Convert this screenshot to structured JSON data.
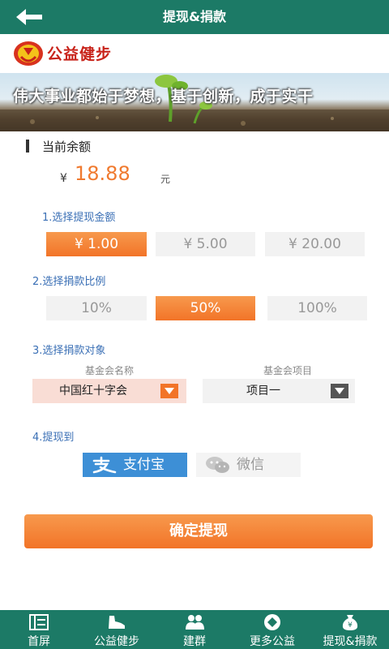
{
  "header": {
    "title": "提现&捐款"
  },
  "logo": {
    "text": "公益健步"
  },
  "banner": {
    "slogan": "伟大事业都始于梦想，基于创新，成于实干"
  },
  "balance": {
    "label": "当前余额",
    "currency": "¥",
    "value": "18.88",
    "unit": "元"
  },
  "steps": {
    "amount": {
      "label": "1.选择提现金额",
      "options": [
        "¥ 1.00",
        "¥ 5.00",
        "¥ 20.00"
      ],
      "selected_index": 0
    },
    "ratio": {
      "label": "2.选择捐款比例",
      "options": [
        "10%",
        "50%",
        "100%"
      ],
      "selected_index": 1
    },
    "target": {
      "label": "3.选择捐款对象",
      "foundation_label": "基金会名称",
      "foundation_value": "中国红十字会",
      "project_label": "基金会项目",
      "project_value": "项目一"
    },
    "withdraw_to": {
      "label": "4.提现到",
      "alipay": "支付宝",
      "wechat": "微信",
      "selected": "alipay"
    }
  },
  "confirm": {
    "label": "确定提现"
  },
  "tabbar": [
    {
      "label": "首屏",
      "icon": "home-list-icon"
    },
    {
      "label": "公益健步",
      "icon": "shoe-icon"
    },
    {
      "label": "建群",
      "icon": "group-icon"
    },
    {
      "label": "更多公益",
      "icon": "more-icon"
    },
    {
      "label": "提现&捐款",
      "icon": "money-bag-icon"
    }
  ],
  "colors": {
    "header": "#1c7a66",
    "accent_orange": "#f27428",
    "step_blue": "#3a6fb5",
    "alipay_blue": "#3d8fd6",
    "logo_red": "#c8231a"
  }
}
